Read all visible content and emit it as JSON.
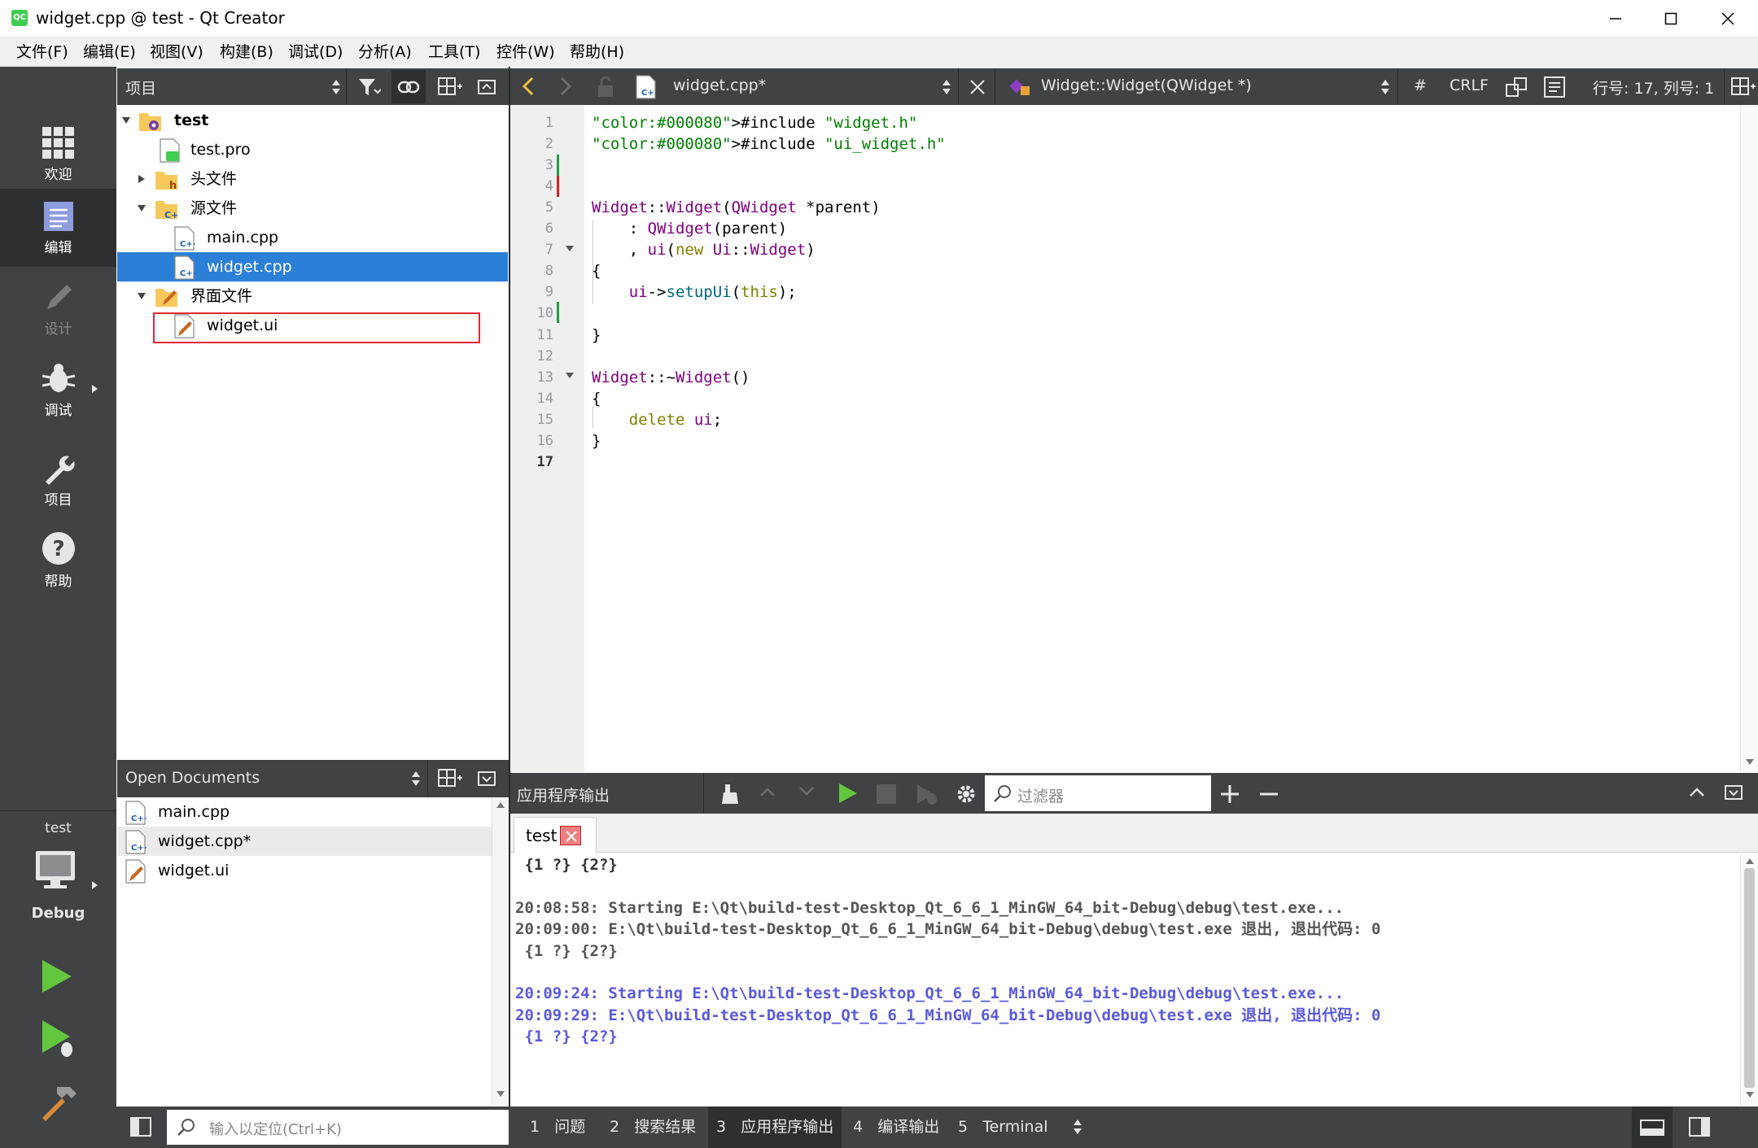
{
  "window": {
    "title": "widget.cpp @ test - Qt Creator",
    "app_icon": "QC"
  },
  "menu": [
    "文件(F)",
    "编辑(E)",
    "视图(V)",
    "构建(B)",
    "调试(D)",
    "分析(A)",
    "工具(T)",
    "控件(W)",
    "帮助(H)"
  ],
  "modes": [
    {
      "label": "欢迎",
      "icon": "grid-icon"
    },
    {
      "label": "编辑",
      "icon": "edit-doc-icon"
    },
    {
      "label": "设计",
      "icon": "pencil-icon"
    },
    {
      "label": "调试",
      "icon": "bug-icon"
    },
    {
      "label": "项目",
      "icon": "wrench-icon"
    },
    {
      "label": "帮助",
      "icon": "help-icon"
    }
  ],
  "kit": {
    "project": "test",
    "config": "Debug"
  },
  "project_panel": {
    "title": "项目",
    "tree": [
      {
        "label": "test",
        "level": 0,
        "expanded": true,
        "bold": true
      },
      {
        "label": "test.pro",
        "level": 1
      },
      {
        "label": "头文件",
        "level": 1,
        "expanded": false
      },
      {
        "label": "源文件",
        "level": 1,
        "expanded": true
      },
      {
        "label": "main.cpp",
        "level": 2
      },
      {
        "label": "widget.cpp",
        "level": 2,
        "selected": true
      },
      {
        "label": "界面文件",
        "level": 1,
        "expanded": true
      },
      {
        "label": "widget.ui",
        "level": 2,
        "highlighted": true
      }
    ]
  },
  "open_documents": {
    "title": "Open Documents",
    "items": [
      "main.cpp",
      "widget.cpp*",
      "widget.ui"
    ]
  },
  "editor": {
    "file_tab": "widget.cpp*",
    "symbol": "Widget::Widget(QWidget *)",
    "hash": "#",
    "line_ending": "CRLF",
    "position": "行号: 17, 列号: 1",
    "line_numbers": [
      "1",
      "2",
      "3",
      "4",
      "5",
      "6",
      "7",
      "8",
      "9",
      "10",
      "11",
      "12",
      "13",
      "14",
      "15",
      "16",
      "17"
    ],
    "code": [
      "#include \"widget.h\"",
      "#include \"ui_widget.h\"",
      "",
      "",
      "Widget::Widget(QWidget *parent)",
      "    : QWidget(parent)",
      "    , ui(new Ui::Widget)",
      "{",
      "    ui->setupUi(this);",
      "",
      "}",
      "",
      "Widget::~Widget()",
      "{",
      "    delete ui;",
      "}",
      ""
    ]
  },
  "output_pane": {
    "title": "应用程序输出",
    "filter_placeholder": "过滤器",
    "tab": "test",
    "lines": [
      {
        "text": " {1 ?} {2?}",
        "color": "#333333"
      },
      {
        "text": "",
        "color": "#333333"
      },
      {
        "text": "20:08:58: Starting E:\\Qt\\build-test-Desktop_Qt_6_6_1_MinGW_64_bit-Debug\\debug\\test.exe...",
        "color": "#555555"
      },
      {
        "text": "20:09:00: E:\\Qt\\build-test-Desktop_Qt_6_6_1_MinGW_64_bit-Debug\\debug\\test.exe 退出, 退出代码: 0",
        "color": "#555555"
      },
      {
        "text": " {1 ?} {2?}",
        "color": "#555555"
      },
      {
        "text": "",
        "color": "#333333"
      },
      {
        "text": "20:09:24: Starting E:\\Qt\\build-test-Desktop_Qt_6_6_1_MinGW_64_bit-Debug\\debug\\test.exe...",
        "color": "#5a5adc"
      },
      {
        "text": "20:09:29: E:\\Qt\\build-test-Desktop_Qt_6_6_1_MinGW_64_bit-Debug\\debug\\test.exe 退出, 退出代码: 0",
        "color": "#5a5adc"
      },
      {
        "text": " {1 ?} {2?}",
        "color": "#5a5adc"
      }
    ]
  },
  "statusbar": {
    "locate_placeholder": "输入以定位(Ctrl+K)",
    "tabs": [
      {
        "num": "1",
        "label": "问题"
      },
      {
        "num": "2",
        "label": "搜索结果"
      },
      {
        "num": "3",
        "label": "应用程序输出"
      },
      {
        "num": "4",
        "label": "编译输出"
      },
      {
        "num": "5",
        "label": "Terminal"
      }
    ]
  }
}
